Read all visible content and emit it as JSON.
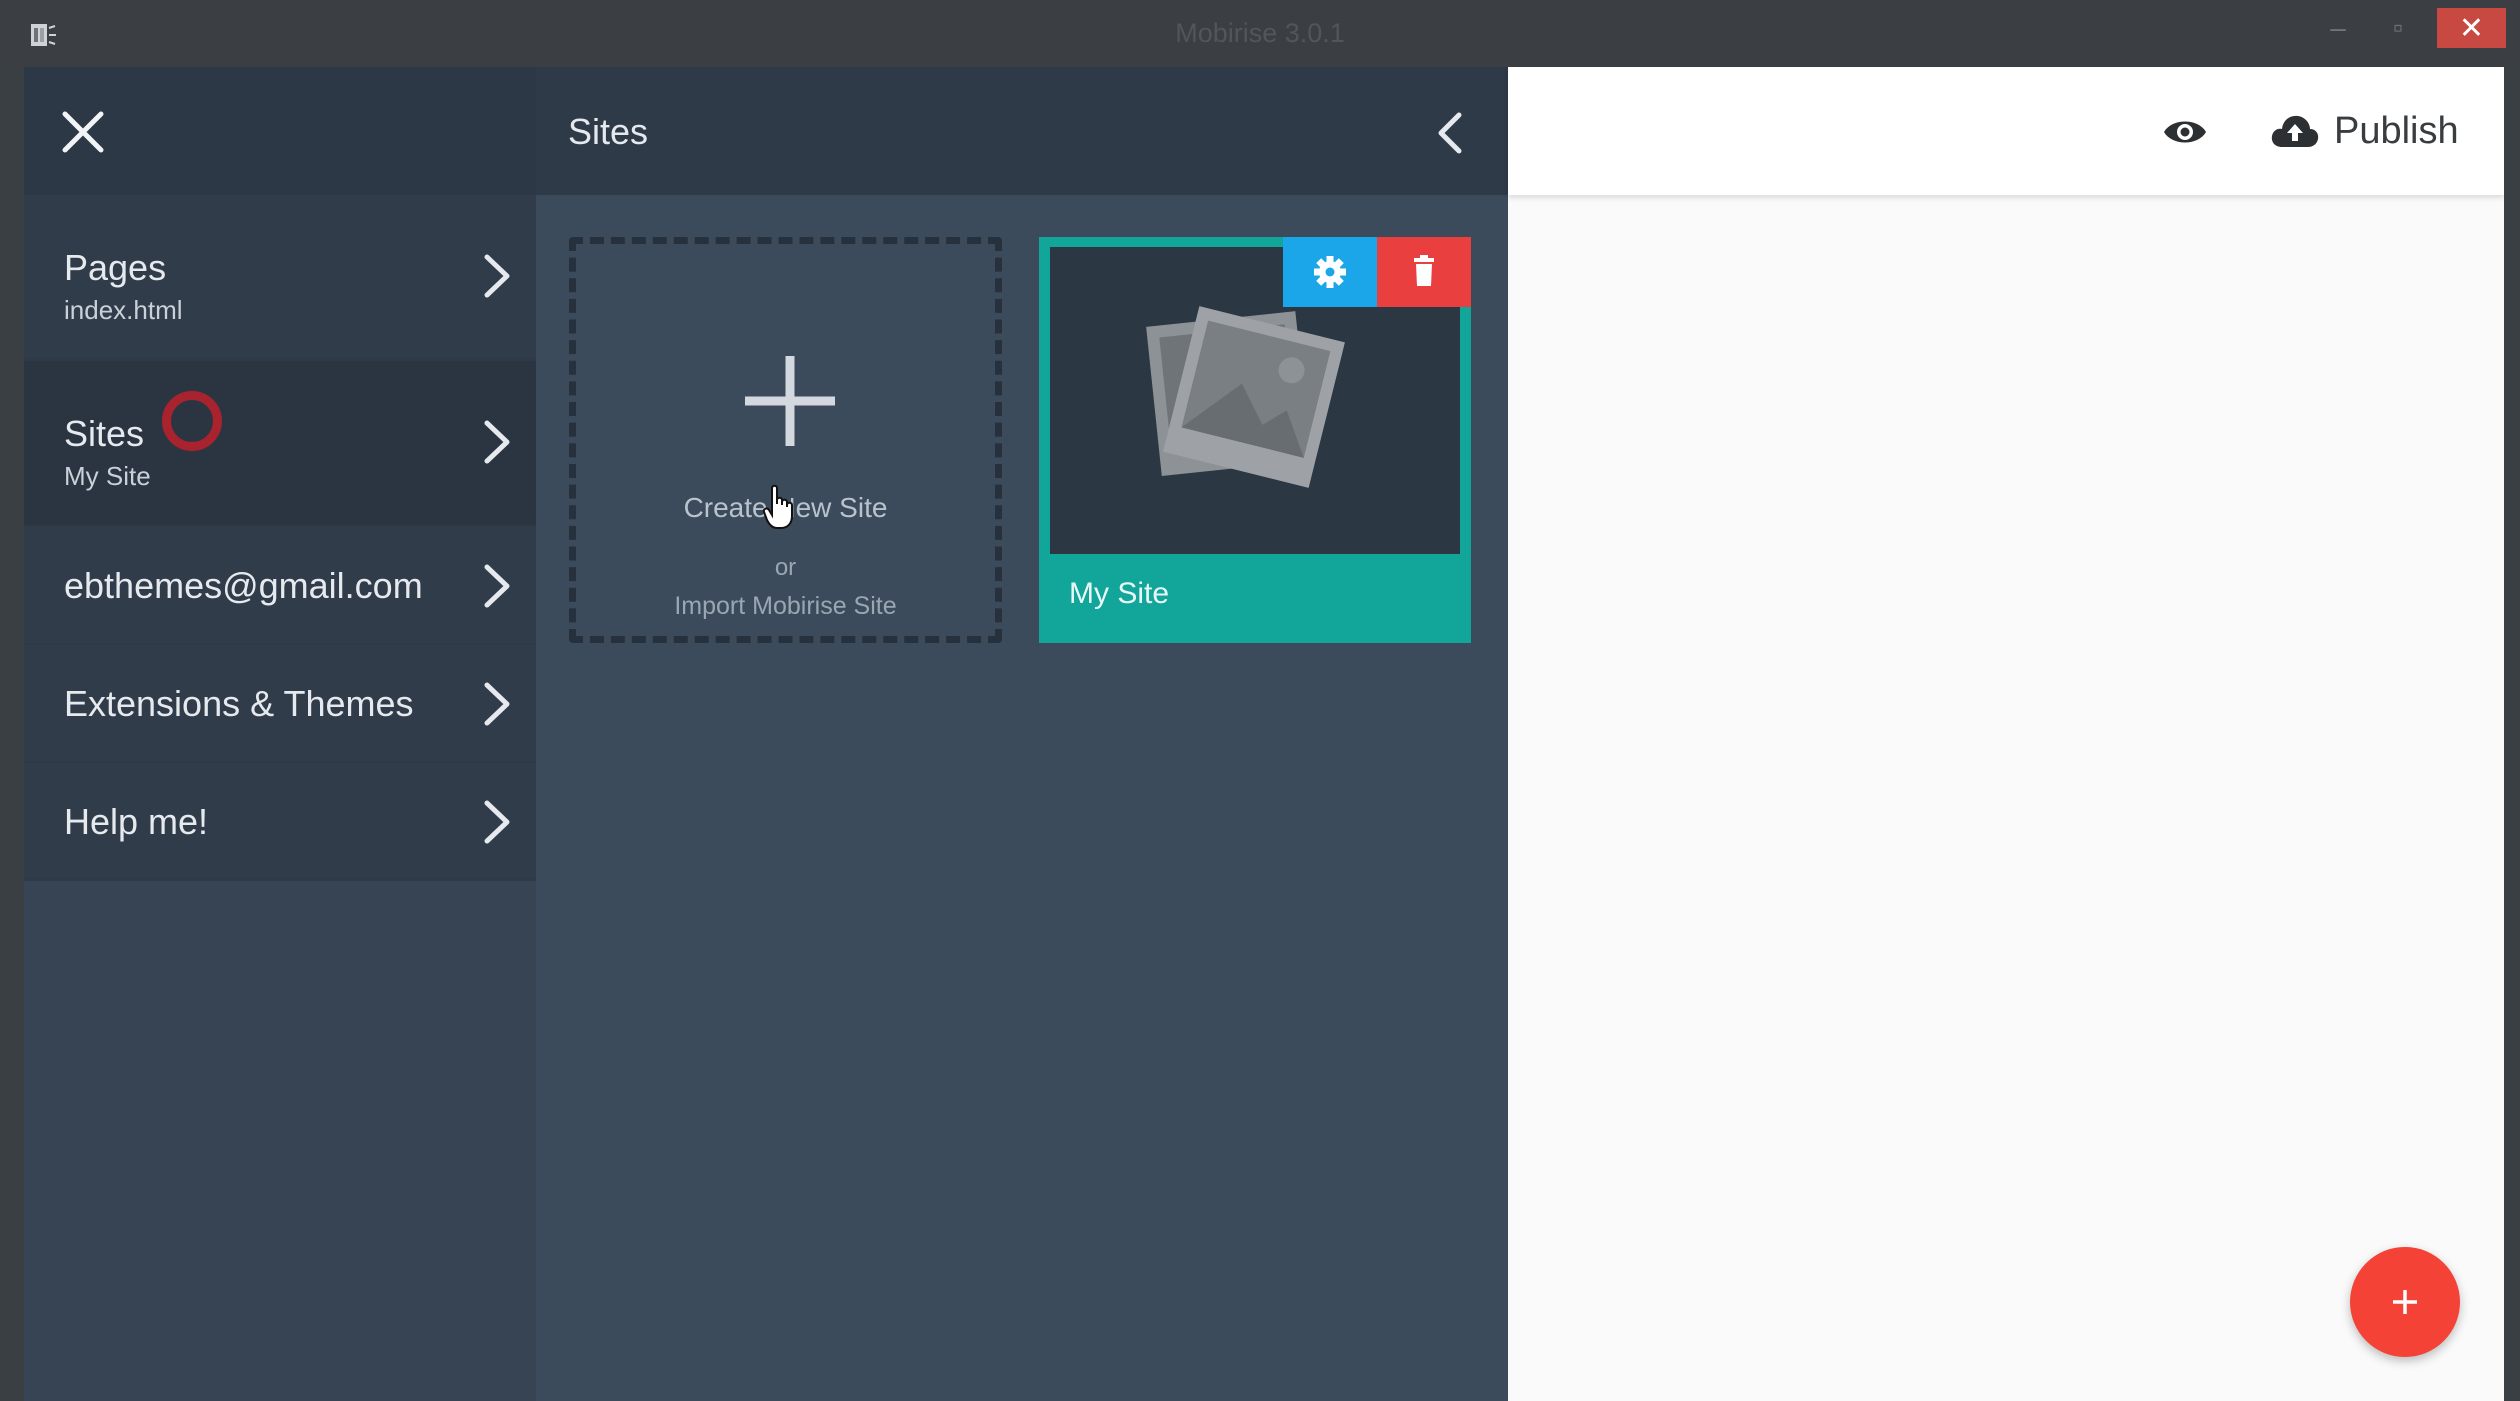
{
  "window": {
    "title": "Mobirise 3.0.1",
    "minimize_glyph": "–",
    "maximize_glyph": "▫",
    "close_glyph": "✕"
  },
  "sidebar": {
    "items": [
      {
        "label": "Pages",
        "sublabel": "index.html"
      },
      {
        "label": "Sites",
        "sublabel": "My Site"
      },
      {
        "label": "ebthemes@gmail.com",
        "sublabel": ""
      },
      {
        "label": "Extensions & Themes",
        "sublabel": ""
      },
      {
        "label": "Help me!",
        "sublabel": ""
      }
    ],
    "active_index": 1
  },
  "sites_panel": {
    "title": "Sites",
    "create_new_label": "Create New Site",
    "or_label": "or",
    "import_label": "Import Mobirise Site",
    "sites": [
      {
        "name": "My Site"
      }
    ]
  },
  "topbar": {
    "publish_label": "Publish"
  },
  "colors": {
    "accent_teal": "#12a59a",
    "settings_blue": "#1aa6e8",
    "delete_red": "#e9403f",
    "fab_red": "#f44336",
    "sidebar_bg": "#364454"
  },
  "icons": [
    "app-icon",
    "close-icon",
    "chevron-right-icon",
    "chevron-left-icon",
    "plus-icon",
    "gear-icon",
    "trash-icon",
    "image-placeholder-icon",
    "eye-icon",
    "cloud-upload-icon",
    "add-icon"
  ]
}
